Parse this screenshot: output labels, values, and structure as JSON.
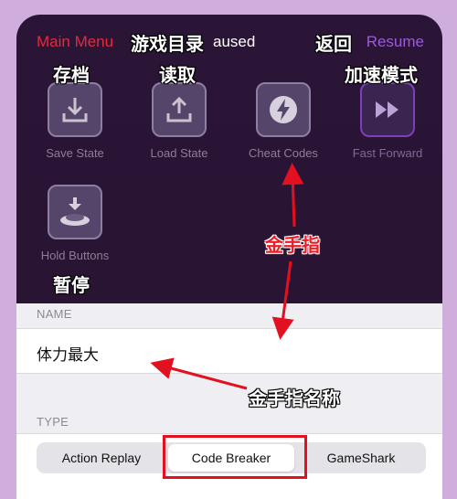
{
  "topbar": {
    "main_menu": "Main Menu",
    "paused": "aused",
    "resume": "Resume"
  },
  "tiles": [
    {
      "label": "Save State",
      "icon": "download-icon"
    },
    {
      "label": "Load State",
      "icon": "upload-icon"
    },
    {
      "label": "Cheat Codes",
      "icon": "lightning-icon"
    },
    {
      "label": "Fast Forward",
      "icon": "fast-forward-icon"
    },
    {
      "label": "Hold Buttons",
      "icon": "hold-buttons-icon"
    }
  ],
  "annotations": {
    "menu": "游戏目录",
    "back": "返回",
    "save": "存档",
    "load": "读取",
    "fast_forward": "加速模式",
    "cheat": "金手指",
    "pause": "暂停",
    "cheat_name": "金手指名称"
  },
  "form": {
    "name_label": "NAME",
    "name_value": "体力最大",
    "type_label": "TYPE",
    "types": [
      "Action Replay",
      "Code Breaker",
      "GameShark"
    ],
    "selected_type": "Code Breaker"
  },
  "colors": {
    "accent_red": "#e8293c",
    "accent_purple": "#9b5bd6",
    "menu_bg": "#2b1537",
    "annotation_red": "#ee1c25"
  }
}
